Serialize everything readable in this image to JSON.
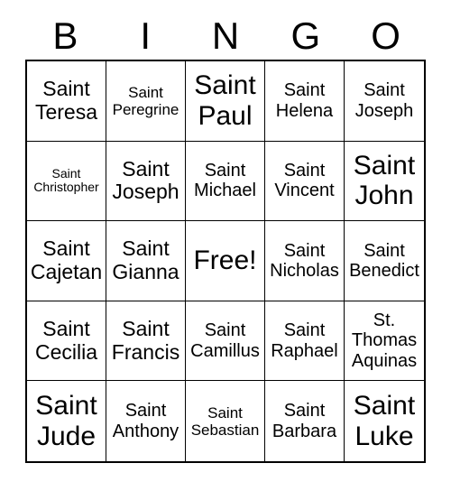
{
  "card": {
    "header": {
      "letters": [
        "B",
        "I",
        "N",
        "G",
        "O"
      ]
    },
    "columns": [
      "B",
      "I",
      "N",
      "G",
      "O"
    ],
    "free_space": {
      "label": "Free!",
      "row": 3,
      "column": 3
    },
    "colors": {
      "background": "#ffffff",
      "text": "#000000",
      "grid_line": "#000000",
      "outer_border": "#000000"
    },
    "rows": [
      [
        {
          "label": "Saint Teresa",
          "size": "lg"
        },
        {
          "label": "Saint Peregrine",
          "size": "sm"
        },
        {
          "label": "Saint Paul",
          "size": "xxl"
        },
        {
          "label": "Saint Helena",
          "size": "md"
        },
        {
          "label": "Saint Joseph",
          "size": "md"
        }
      ],
      [
        {
          "label": "Saint Christopher",
          "size": "xs"
        },
        {
          "label": "Saint Joseph",
          "size": "lg"
        },
        {
          "label": "Saint Michael",
          "size": "md"
        },
        {
          "label": "Saint Vincent",
          "size": "md"
        },
        {
          "label": "Saint John",
          "size": "xxl"
        }
      ],
      [
        {
          "label": "Saint Cajetan",
          "size": "lg"
        },
        {
          "label": "Saint Gianna",
          "size": "lg"
        },
        {
          "label": "Free!",
          "size": "xxl"
        },
        {
          "label": "Saint Nicholas",
          "size": "md"
        },
        {
          "label": "Saint Benedict",
          "size": "md"
        }
      ],
      [
        {
          "label": "Saint Cecilia",
          "size": "lg"
        },
        {
          "label": "Saint Francis",
          "size": "lg"
        },
        {
          "label": "Saint Camillus",
          "size": "md"
        },
        {
          "label": "Saint Raphael",
          "size": "md"
        },
        {
          "label": "St. Thomas Aquinas",
          "size": "md"
        }
      ],
      [
        {
          "label": "Saint Jude",
          "size": "xxl"
        },
        {
          "label": "Saint Anthony",
          "size": "md"
        },
        {
          "label": "Saint Sebastian",
          "size": "sm"
        },
        {
          "label": "Saint Barbara",
          "size": "md"
        },
        {
          "label": "Saint Luke",
          "size": "xxl"
        }
      ]
    ]
  }
}
